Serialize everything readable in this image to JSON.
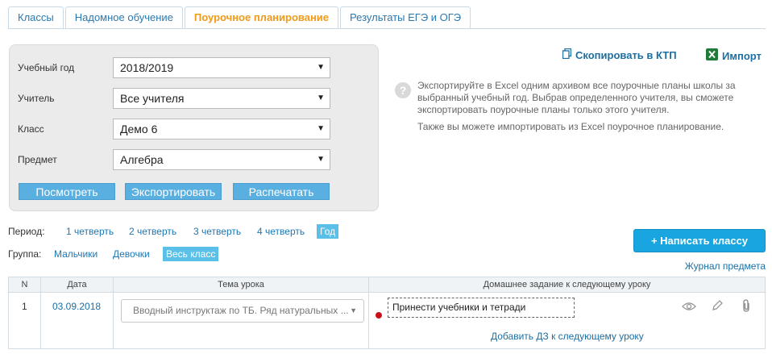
{
  "tabs": [
    {
      "label": "Классы"
    },
    {
      "label": "Надомное обучение"
    },
    {
      "label": "Поурочное планирование",
      "active": true
    },
    {
      "label": "Результаты ЕГЭ и ОГЭ"
    }
  ],
  "filters": {
    "year": {
      "label": "Учебный год",
      "value": "2018/2019"
    },
    "teacher": {
      "label": "Учитель",
      "value": "Все учителя"
    },
    "class": {
      "label": "Класс",
      "value": "Демо 6"
    },
    "subject": {
      "label": "Предмет",
      "value": "Алгебра"
    }
  },
  "buttons": {
    "view": "Посмотреть",
    "export": "Экспортировать",
    "print": "Распечатать",
    "write_class": "+ Написать классу"
  },
  "links": {
    "copy_ktp": "Скопировать в КТП",
    "import": "Импорт",
    "journal": "Журнал предмета",
    "add_hw": "Добавить ДЗ к следующему уроку"
  },
  "help": {
    "p1": "Экспортируйте в Excel одним архивом все поурочные планы школы за выбранный учебный год. Выбрав определенного учителя, вы сможете экспортировать поурочные планы только этого учителя.",
    "p2": "Также вы можете импортировать из Excel поурочное планирование."
  },
  "period": {
    "label": "Период:",
    "items": [
      "1 четверть",
      "2 четверть",
      "3 четверть",
      "4 четверть",
      "Год"
    ],
    "active": "Год"
  },
  "group": {
    "label": "Группа:",
    "items": [
      "Мальчики",
      "Девочки",
      "Весь класс"
    ],
    "active": "Весь класс"
  },
  "table": {
    "headers": {
      "n": "N",
      "date": "Дата",
      "topic": "Тема урока",
      "homework": "Домашнее задание к следующему уроку"
    },
    "rows": [
      {
        "n": "1",
        "date": "03.09.2018",
        "topic": "Вводный инструктаж по ТБ. Ряд натуральных ...",
        "homework": "Принести учебники и тетради"
      }
    ]
  },
  "colors": {
    "accent": "#f09a1a",
    "link": "#1b6fa3",
    "button": "#59afe0",
    "primary": "#19a5e0",
    "active_pill": "#5bc0e8"
  },
  "icons": {
    "copy": "copy-icon",
    "excel": "excel-icon",
    "help": "question-icon",
    "view": "eye-icon",
    "edit": "pencil-icon",
    "attach": "paperclip-icon"
  }
}
